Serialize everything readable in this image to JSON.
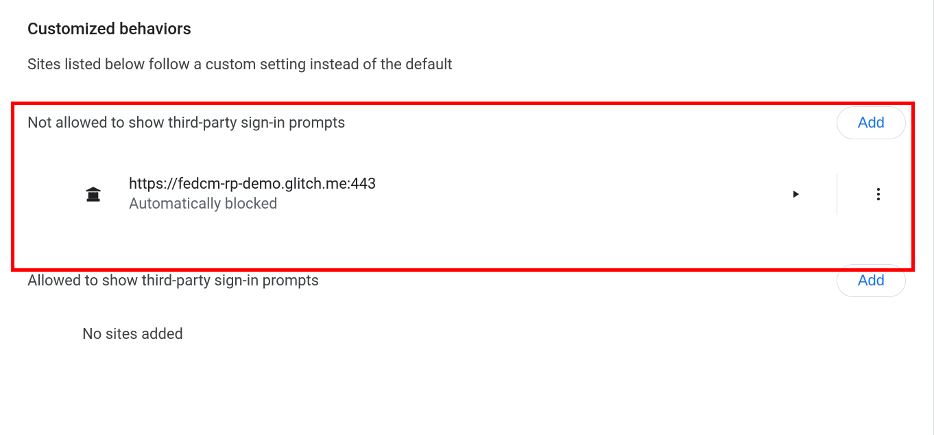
{
  "page": {
    "title": "Customized behaviors",
    "description": "Sites listed below follow a custom setting instead of the default"
  },
  "not_allowed": {
    "label": "Not allowed to show third-party sign-in prompts",
    "add_label": "Add",
    "sites": [
      {
        "url": "https://fedcm-rp-demo.glitch.me:443",
        "status": "Automatically blocked"
      }
    ]
  },
  "allowed": {
    "label": "Allowed to show third-party sign-in prompts",
    "add_label": "Add",
    "empty": "No sites added"
  }
}
